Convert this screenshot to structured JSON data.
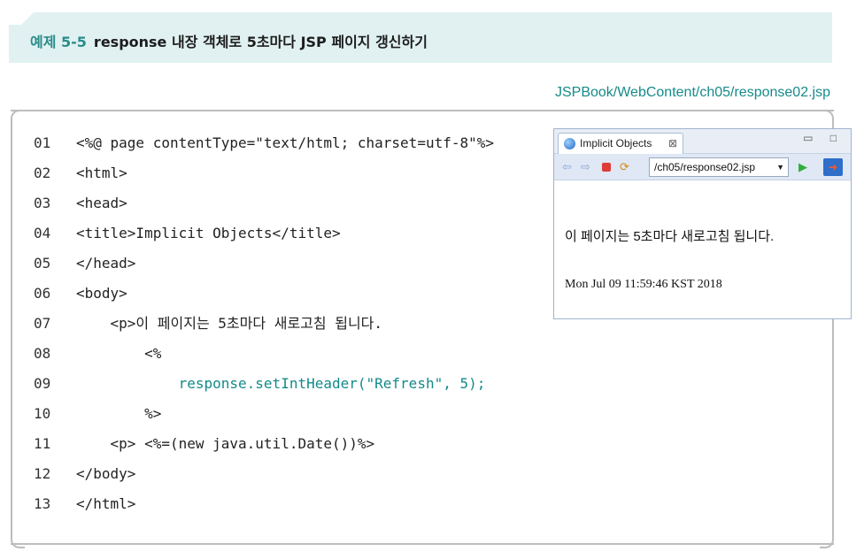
{
  "header": {
    "example_number": "예제 5-5",
    "title": "response 내장 객체로 5초마다 JSP 페이지 갱신하기"
  },
  "file_path": "JSPBook/WebContent/ch05/response02.jsp",
  "code_lines": [
    {
      "num": "01",
      "text": "<%@ page contentType=\"text/html; charset=utf-8\"%>"
    },
    {
      "num": "02",
      "text": "<html>"
    },
    {
      "num": "03",
      "text": "<head>"
    },
    {
      "num": "04",
      "text": "<title>Implicit Objects</title>"
    },
    {
      "num": "05",
      "text": "</head>"
    },
    {
      "num": "06",
      "text": "<body>"
    },
    {
      "num": "07",
      "text": "    <p>이 페이지는 5초마다 새로고침 됩니다."
    },
    {
      "num": "08",
      "text": "        <%"
    },
    {
      "num": "09",
      "text": "            response.setIntHeader(\"Refresh\", 5);"
    },
    {
      "num": "10",
      "text": "        %>"
    },
    {
      "num": "11",
      "text": "    <p> <%=(new java.util.Date())%>"
    },
    {
      "num": "12",
      "text": "</body>"
    },
    {
      "num": "13",
      "text": "</html>"
    }
  ],
  "browser": {
    "tab_title": "Implicit Objects",
    "tab_close": "⊠",
    "window_controls": "▭ □",
    "url": "/ch05/response02.jsp",
    "content_line1": "이 페이지는 5초마다 새로고침 됩니다.",
    "content_line2": "Mon Jul 09 11:59:46 KST 2018"
  },
  "colors": {
    "accent": "#148a8a",
    "header_band": "#e1f1f1"
  }
}
